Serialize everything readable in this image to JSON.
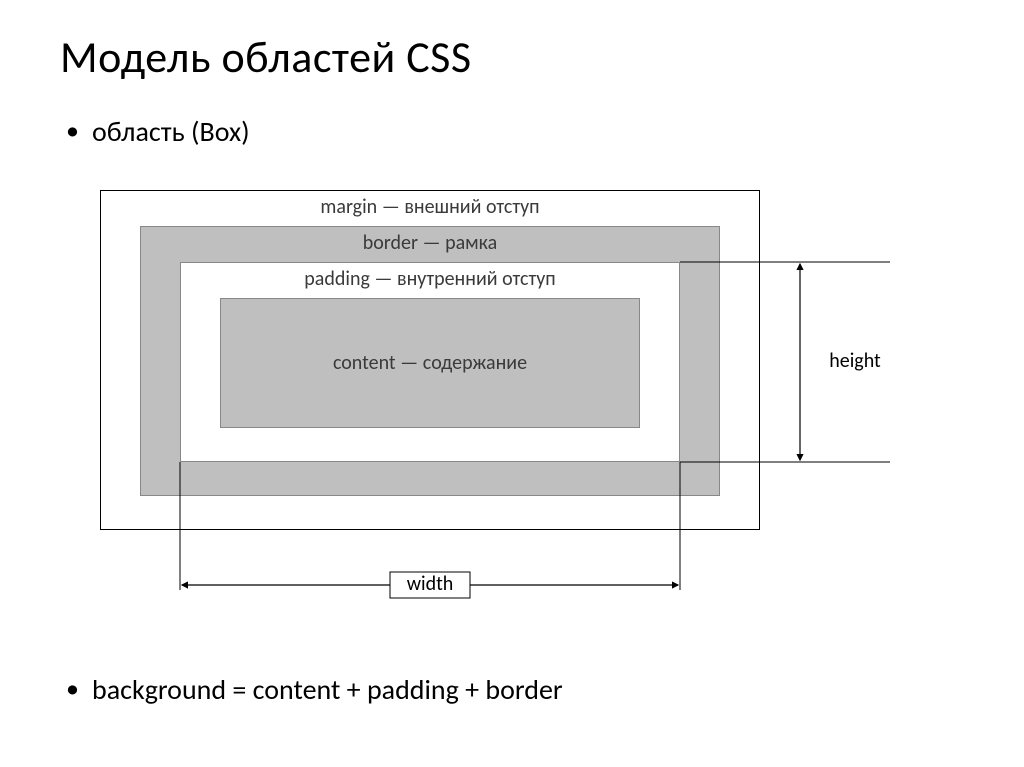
{
  "title": "Модель областей CSS",
  "bullets": {
    "item1": "область (Box)",
    "item2": "background = content + padding + border"
  },
  "diagram": {
    "margin_label": "margin — внешний отступ",
    "border_label": "border — рамка",
    "padding_label": "padding — внутренний отступ",
    "content_label": "content — содержание",
    "width_label": "width",
    "height_label": "height"
  }
}
